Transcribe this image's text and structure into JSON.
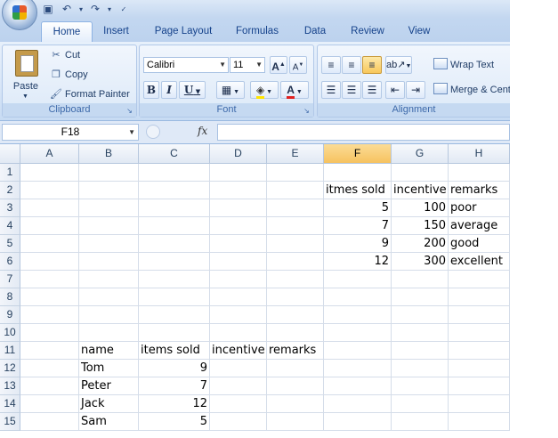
{
  "tabs": [
    "Home",
    "Insert",
    "Page Layout",
    "Formulas",
    "Data",
    "Review",
    "View"
  ],
  "clipboard": {
    "title": "Clipboard",
    "paste": "Paste",
    "cut": "Cut",
    "copy": "Copy",
    "format_painter": "Format Painter"
  },
  "font": {
    "title": "Font",
    "name": "Calibri",
    "size": "11",
    "grow": "A",
    "shrink": "A",
    "bold": "B",
    "italic": "I",
    "underline": "U",
    "font_color": "A"
  },
  "alignment": {
    "title": "Alignment",
    "wrap_text": "Wrap Text",
    "merge_center": "Merge & Center"
  },
  "formula_bar": {
    "name_box": "F18",
    "fx": "fx",
    "value": ""
  },
  "sheet": {
    "columns": [
      "A",
      "B",
      "C",
      "D",
      "E",
      "F",
      "G",
      "H"
    ],
    "selected_column": "F",
    "rows": [
      "1",
      "2",
      "3",
      "4",
      "5",
      "6",
      "7",
      "8",
      "9",
      "10",
      "11",
      "12",
      "13",
      "14",
      "15"
    ],
    "cells": {
      "F2": "itmes sold",
      "G2": "incentive",
      "H2": "remarks",
      "F3": "5",
      "G3": "100",
      "H3": "poor",
      "F4": "7",
      "G4": "150",
      "H4": "average",
      "F5": "9",
      "G5": "200",
      "H5": "good",
      "F6": "12",
      "G6": "300",
      "H6": "excellent",
      "B11": "name",
      "C11": "items sold",
      "D11": "incentive",
      "E11": "remarks",
      "B12": "Tom",
      "C12": "9",
      "B13": "Peter",
      "C13": "7",
      "B14": "Jack",
      "C14": "12",
      "B15": "Sam",
      "C15": "5"
    },
    "numeric_cells": [
      "F3",
      "G3",
      "F4",
      "G4",
      "F5",
      "G5",
      "F6",
      "G6",
      "C12",
      "C13",
      "C14",
      "C15"
    ]
  },
  "colors": {
    "ribbon": "#dce8f7",
    "selected_header": "#f6c25f",
    "tab_text": "#15428b"
  }
}
